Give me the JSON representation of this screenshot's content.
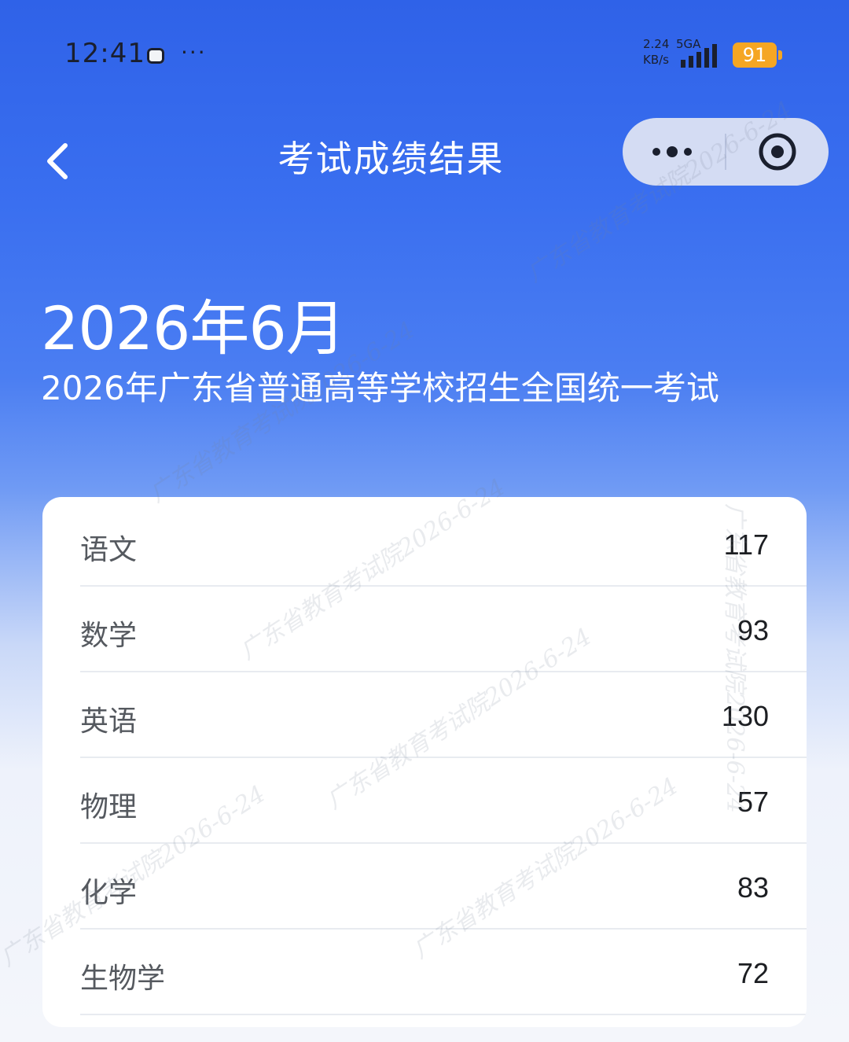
{
  "status_bar": {
    "time": "12:41",
    "more_dots": "···",
    "network_speed": "2.24\nKB/s",
    "network_speed_value": "2.24",
    "network_speed_unit": "KB/s",
    "network_type": "5GA",
    "battery": "91",
    "battery_color": "#f5a623"
  },
  "nav": {
    "back_icon": "chevron-left-icon",
    "title": "考试成绩结果",
    "more_icon": "more-dots-icon",
    "close_icon": "target-close-icon"
  },
  "header": {
    "exam_date": "2026年6月",
    "exam_name": "2026年广东省普通高等学校招生全国统一考试"
  },
  "scores": [
    {
      "subject": "语文",
      "score": "117"
    },
    {
      "subject": "数学",
      "score": "93"
    },
    {
      "subject": "英语",
      "score": "130"
    },
    {
      "subject": "物理",
      "score": "57"
    },
    {
      "subject": "化学",
      "score": "83"
    },
    {
      "subject": "生物学",
      "score": "72"
    }
  ],
  "watermark_text": "广东省教育考试院2026-6-24",
  "colors": {
    "header_blue": "#2f62e8",
    "card_bg": "#ffffff",
    "title_text": "#ffffff"
  }
}
